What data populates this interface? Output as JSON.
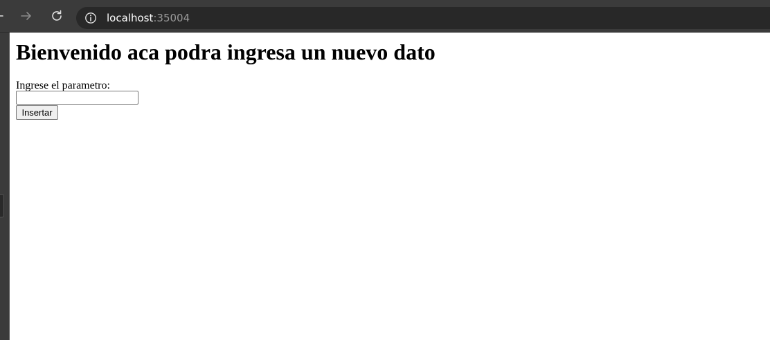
{
  "browser": {
    "address": {
      "host": "localhost",
      "port": ":35004"
    },
    "icons": {
      "back": "arrow-left-icon",
      "forward": "arrow-right-icon",
      "reload": "reload-icon",
      "site_info": "info-icon"
    }
  },
  "page": {
    "title": "Bienvenido aca podra ingresa un nuevo dato",
    "form": {
      "label": "Ingrese el parametro:",
      "input_value": "",
      "submit_label": "Insertar"
    }
  }
}
